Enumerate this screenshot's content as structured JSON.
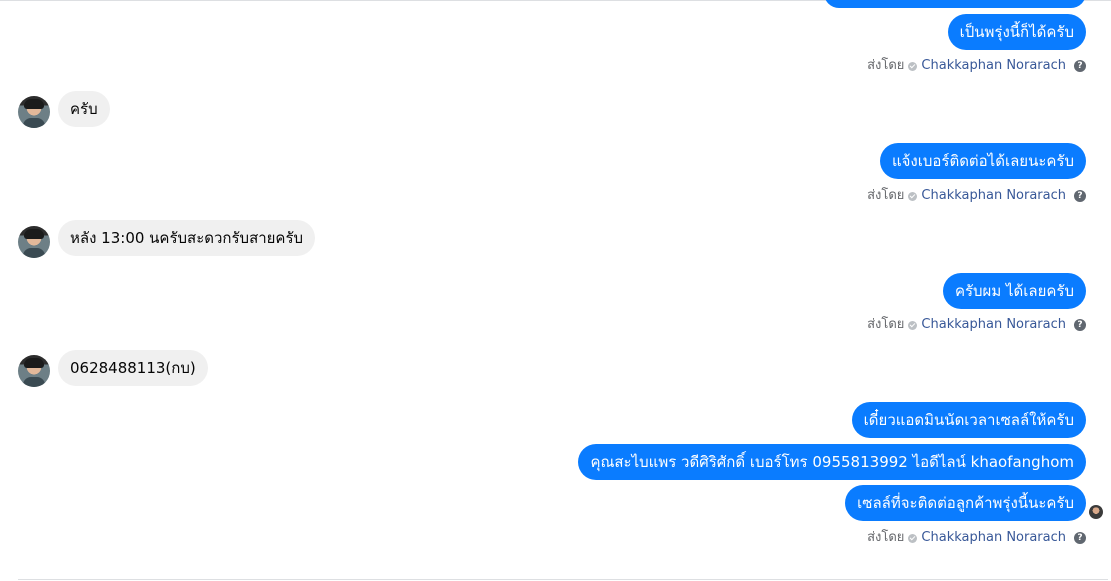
{
  "conversation": {
    "messages": {
      "m1": "เป็นพรุ่งนี้ก็ได้ครับ",
      "m2": "ครับ",
      "m3": "แจ้งเบอร์ติดต่อได้เลยนะครับ",
      "m4": "หลัง 13:00 นครับสะดวกรับสายครับ",
      "m5": "ครับผม ได้เลยครับ",
      "m6": "0628488113(กบ)",
      "m7": "เดี๋ยวแอดมินนัดเวลาเซลล์ให้ครับ",
      "m8": "คุณสะไบแพร วดีศิริศักดิ์ เบอร์โทร 0955813992  ไอดีไลน์  khaofanghom",
      "m9": "เซลล์ที่จะติดต่อลูกค้าพรุ่งนี้นะครับ"
    },
    "sent_by": {
      "prefix": "ส่งโดย",
      "name": "Chakkaphan Norarach",
      "help_icon": "?"
    }
  },
  "icons": {
    "avatar": "avatar-icon",
    "verified": "check-circle-icon",
    "help": "question-circle-icon",
    "seen": "seen-avatar-icon"
  },
  "colors": {
    "outgoing_bubble": "#0a7cff",
    "incoming_bubble": "#f0f0f0",
    "sender_link": "#385898",
    "meta_text": "#65676b"
  }
}
